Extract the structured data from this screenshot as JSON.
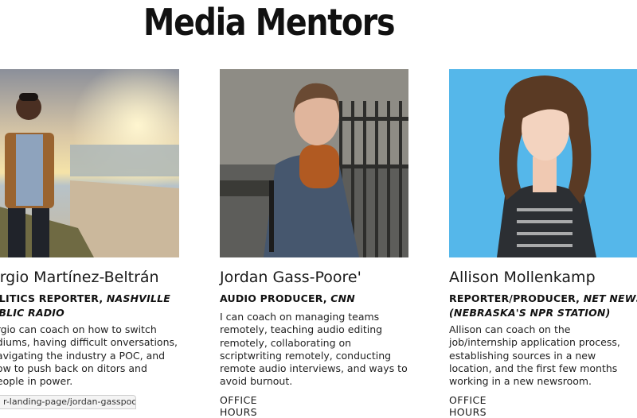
{
  "page": {
    "title": "Media Mentors"
  },
  "mentors": [
    {
      "name": "ergio Martínez-Beltrán",
      "role_prefix": "OLITICS REPORTER, ",
      "role_outlet": "NASHVILLE UBLIC RADIO",
      "bio": "ergio can coach on how to switch ediums, having difficult onversations, navigating the industry a POC, and how to push back on ditors and people in power."
    },
    {
      "name": "Jordan Gass-Poore'",
      "role_prefix": "AUDIO PRODUCER, ",
      "role_outlet": "CNN",
      "bio": "I can coach on managing teams remotely, teaching audio editing remotely, collaborating on scriptwriting remotely, conducting remote audio interviews, and ways to avoid burnout.",
      "office_hours": "OFFICE HOURS"
    },
    {
      "name": "Allison Mollenkamp",
      "role_prefix": "REPORTER/PRODUCER, ",
      "role_outlet": "NET NEWS (NEBRASKA'S NPR STATION)",
      "bio": "Allison can coach on the job/internship application process, establishing sources in a new location, and the first few months working in a new newsroom.",
      "office_hours": "OFFICE HOURS"
    }
  ],
  "status_bar": {
    "url": "r-landing-page/jordan-gasspoore"
  }
}
